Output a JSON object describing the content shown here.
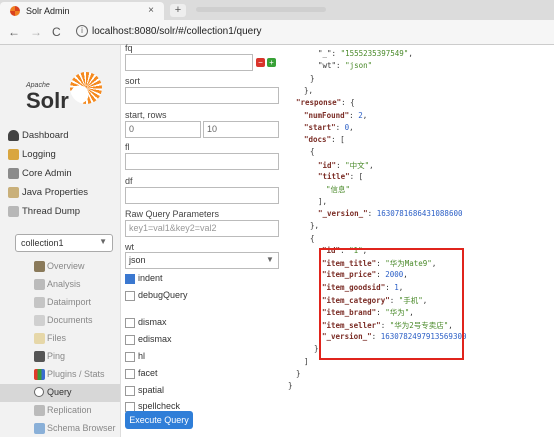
{
  "browser": {
    "tab_title": "Solr Admin",
    "tab_close": "×",
    "new_tab": "+",
    "back": "←",
    "forward": "→",
    "reload": "C",
    "info": "i",
    "url": "localhost:8080/solr/#/collection1/query"
  },
  "logo": {
    "apache": "Apache",
    "solr": "Solr"
  },
  "sidebar": {
    "items": [
      {
        "label": "Dashboard"
      },
      {
        "label": "Logging"
      },
      {
        "label": "Core Admin"
      },
      {
        "label": "Java Properties"
      },
      {
        "label": "Thread Dump"
      }
    ],
    "core_selector": {
      "value": "collection1",
      "caret": "▼"
    },
    "core_items": [
      {
        "label": "Overview"
      },
      {
        "label": "Analysis"
      },
      {
        "label": "Dataimport"
      },
      {
        "label": "Documents"
      },
      {
        "label": "Files"
      },
      {
        "label": "Ping"
      },
      {
        "label": "Plugins / Stats"
      },
      {
        "label": "Query"
      },
      {
        "label": "Replication"
      },
      {
        "label": "Schema Browser"
      }
    ]
  },
  "form": {
    "q_label": "fq",
    "sort_label": "sort",
    "start_rows_label": "start, rows",
    "start_value": "0",
    "rows_value": "10",
    "fl_label": "fl",
    "df_label": "df",
    "raw_label": "Raw Query Parameters",
    "raw_placeholder": "key1=val1&key2=val2",
    "wt_label": "wt",
    "wt_value": "json",
    "wt_caret": "▼",
    "indent_label": "indent",
    "debug_label": "debugQuery",
    "dismax_label": "dismax",
    "edismax_label": "edismax",
    "hl_label": "hl",
    "facet_label": "facet",
    "spatial_label": "spatial",
    "spellcheck_label": "spellcheck",
    "execute_label": "Execute Query",
    "remove_btn": "−",
    "add_btn": "+"
  },
  "result": {
    "lines": [
      {
        "t": [
          [
            "p",
            "\"_\": "
          ],
          [
            "s",
            "\"1555235397549\""
          ],
          [
            "p",
            ","
          ]
        ]
      },
      {
        "t": [
          [
            "p",
            "\"wt\": "
          ],
          [
            "s",
            "\"json\""
          ]
        ]
      },
      {
        "t": [
          [
            "p",
            "}"
          ]
        ]
      },
      {
        "t": [
          [
            "p",
            "},"
          ]
        ]
      },
      {
        "t": [
          [
            "k",
            "\"response\""
          ],
          [
            "p",
            ": {"
          ]
        ]
      },
      {
        "t": [
          [
            "k",
            "\"numFound\""
          ],
          [
            "p",
            ": "
          ],
          [
            "n",
            "2"
          ],
          [
            "p",
            ","
          ]
        ]
      },
      {
        "t": [
          [
            "k",
            "\"start\""
          ],
          [
            "p",
            ": "
          ],
          [
            "n",
            "0"
          ],
          [
            "p",
            ","
          ]
        ]
      },
      {
        "t": [
          [
            "k",
            "\"docs\""
          ],
          [
            "p",
            ": ["
          ]
        ]
      },
      {
        "t": [
          [
            "p",
            "{"
          ]
        ]
      },
      {
        "t": [
          [
            "k",
            "\"id\""
          ],
          [
            "p",
            ": "
          ],
          [
            "s",
            "\"中文\""
          ],
          [
            "p",
            ","
          ]
        ]
      },
      {
        "t": [
          [
            "k",
            "\"title\""
          ],
          [
            "p",
            ": ["
          ]
        ]
      },
      {
        "t": [
          [
            "s",
            "\"信息\""
          ]
        ]
      },
      {
        "t": [
          [
            "p",
            "],"
          ]
        ]
      },
      {
        "t": [
          [
            "k",
            "\"_version_\""
          ],
          [
            "p",
            ": "
          ],
          [
            "n",
            "1630781686431088600"
          ]
        ]
      },
      {
        "t": [
          [
            "p",
            "},"
          ]
        ]
      },
      {
        "t": [
          [
            "p",
            "{"
          ]
        ]
      },
      {
        "t": [
          [
            "k",
            "\"id\""
          ],
          [
            "p",
            ": "
          ],
          [
            "s",
            "\"1\""
          ],
          [
            "p",
            ","
          ]
        ]
      },
      {
        "t": [
          [
            "k",
            "\"item_title\""
          ],
          [
            "p",
            ": "
          ],
          [
            "s",
            "\"华为Mate9\""
          ],
          [
            "p",
            ","
          ]
        ]
      },
      {
        "t": [
          [
            "k",
            "\"item_price\""
          ],
          [
            "p",
            ": "
          ],
          [
            "n",
            "2000"
          ],
          [
            "p",
            ","
          ]
        ]
      },
      {
        "t": [
          [
            "k",
            "\"item_goodsid\""
          ],
          [
            "p",
            ": "
          ],
          [
            "n",
            "1"
          ],
          [
            "p",
            ","
          ]
        ]
      },
      {
        "t": [
          [
            "k",
            "\"item_category\""
          ],
          [
            "p",
            ": "
          ],
          [
            "s",
            "\"手机\""
          ],
          [
            "p",
            ","
          ]
        ]
      },
      {
        "t": [
          [
            "k",
            "\"item_brand\""
          ],
          [
            "p",
            ": "
          ],
          [
            "s",
            "\"华为\""
          ],
          [
            "p",
            ","
          ]
        ]
      },
      {
        "t": [
          [
            "k",
            "\"item_seller\""
          ],
          [
            "p",
            ": "
          ],
          [
            "s",
            "\"华为2号专卖店\""
          ],
          [
            "p",
            ","
          ]
        ]
      },
      {
        "t": [
          [
            "k",
            "\"_version_\""
          ],
          [
            "p",
            ": "
          ],
          [
            "n",
            "1630782497913569300"
          ]
        ]
      },
      {
        "t": [
          [
            "p",
            "}"
          ]
        ]
      },
      {
        "t": [
          [
            "p",
            "]"
          ]
        ]
      },
      {
        "t": [
          [
            "p",
            "}"
          ]
        ]
      },
      {
        "t": [
          [
            "p",
            "}"
          ]
        ]
      }
    ]
  },
  "colors": {
    "accent": "#2f7ed8",
    "highlight": "#e0241c",
    "solr_orange": "#f58a1f"
  }
}
